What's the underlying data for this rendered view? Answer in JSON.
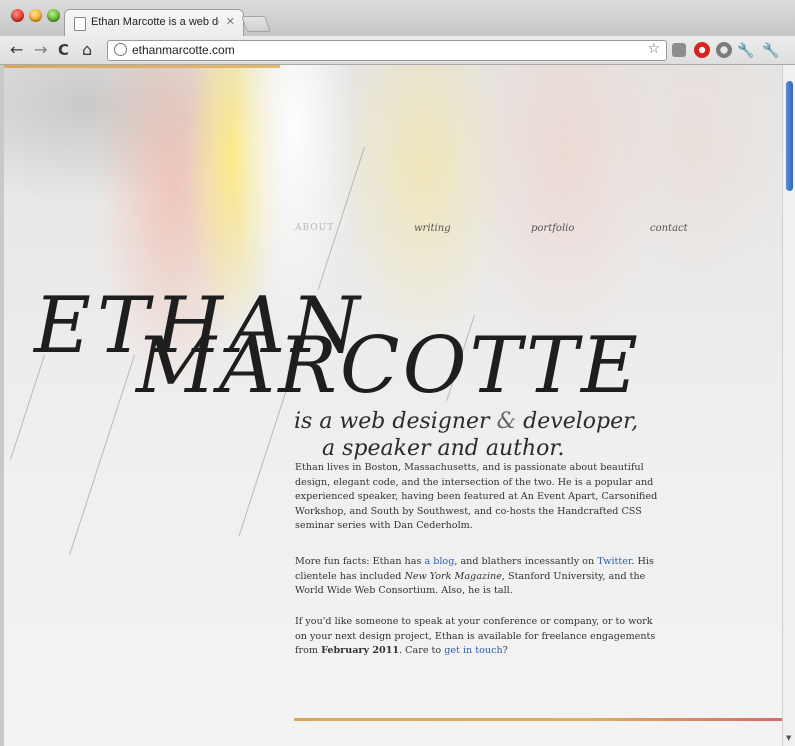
{
  "browser": {
    "tab_title": "Ethan Marcotte is a web des",
    "tab_close": "✕",
    "url": "ethanmarcotte.com",
    "back": "←",
    "forward": "→",
    "reload": "C",
    "home": "⌂",
    "star": "☆"
  },
  "nav": {
    "items": [
      {
        "label": "ABOUT"
      },
      {
        "label": "writing"
      },
      {
        "label": "portfolio"
      },
      {
        "label": "contact"
      }
    ]
  },
  "hero": {
    "first": "ETHAN",
    "last": "MARCOTTE"
  },
  "tagline": {
    "line1_pre": "is a web designer ",
    "amp": "&",
    "line1_post": " developer,",
    "line2": "a speaker and author."
  },
  "bio": {
    "p1": "Ethan lives in Boston, Massachusetts, and is passionate about beautiful design, elegant code, and the intersection of the two. He is a popular and experienced speaker, having been featured at An Event Apart, Carsonified Workshop, and South by Southwest, and co-hosts the Handcrafted CSS seminar series with Dan Cederholm.",
    "p2_a": "More fun facts: Ethan has ",
    "p2_link1": "a blog",
    "p2_b": ", and blathers incessantly on ",
    "p2_link2": "Twitter",
    "p2_c": ". His clientele has included ",
    "p2_em": "New York Magazine",
    "p2_d": ", Stanford University, and the World Wide Web Consortium. Also, he is tall.",
    "p3_a": "If you'd like someone to speak at your conference or company, or to work on your next design project, Ethan is available for freelance engagements from ",
    "p3_strong": "February 2011",
    "p3_b": ". Care to ",
    "p3_link": "get in touch",
    "p3_c": "?"
  },
  "colors": {
    "link": "#2a5fb0",
    "accent_rule": "#d7a85c",
    "scroll_thumb": "#2f66c0"
  }
}
